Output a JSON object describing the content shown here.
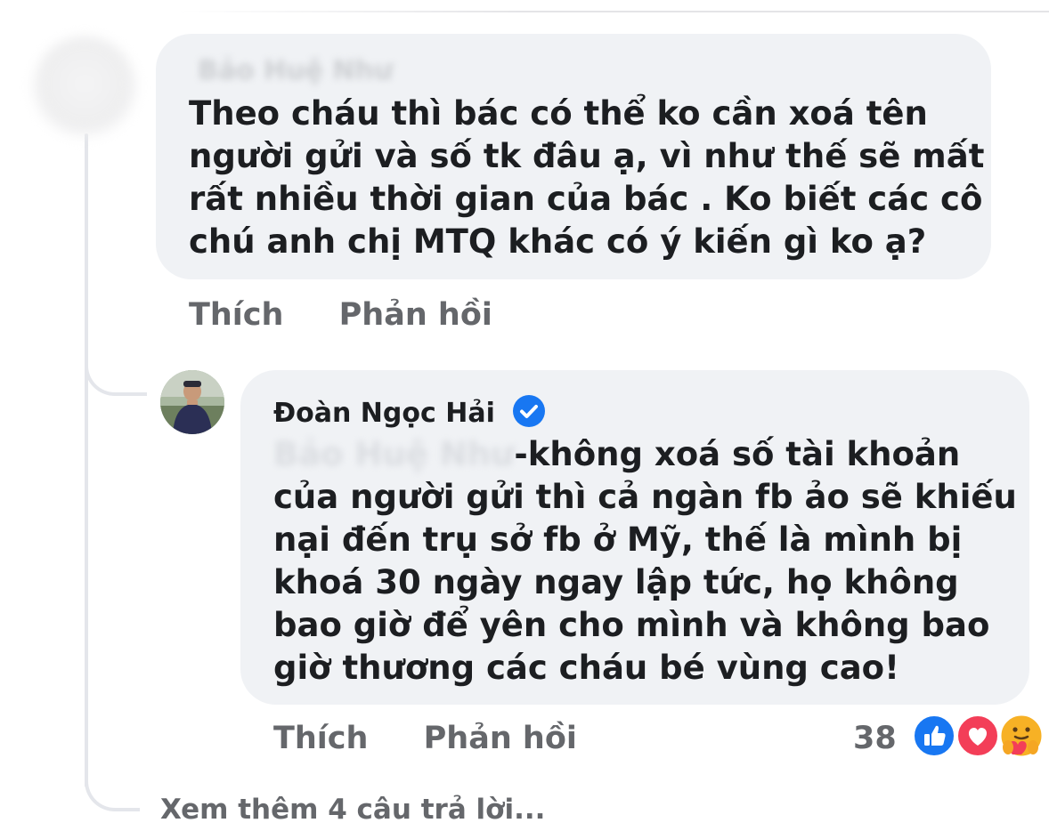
{
  "thread": {
    "parent_comment": {
      "author": "Bảo Huệ Như",
      "lines": [
        "Theo cháu thì bác có thể ko cần xoá tên",
        "người gửi và số tk đâu ạ, vì như thế sẽ mất",
        "rất nhiều thời gian của bác . Ko biết các cô",
        "chú anh chị MTQ khác có ý kiến gì ko ạ?"
      ],
      "actions": {
        "like_label": "Thích",
        "reply_label": "Phản hồi"
      }
    },
    "reply_comment": {
      "author": "Đoàn Ngọc Hải",
      "mention": "Bảo Huệ Như",
      "lines": [
        "-không xoá số tài khoản",
        "của người gửi thì cả ngàn fb ảo sẽ khiếu",
        "nại đến trụ sở fb ở Mỹ, thế là mình bị",
        "khoá 30 ngày ngay lập tức, họ không",
        "bao giờ để yên cho mình và không bao",
        "giờ thương các cháu bé vùng cao!"
      ],
      "actions": {
        "like_label": "Thích",
        "reply_label": "Phản hồi"
      },
      "reactions": {
        "count": "38",
        "types": [
          "like-icon",
          "love-icon",
          "care-icon"
        ]
      }
    },
    "more_replies_label": "Xem thêm 4 câu trả lời..."
  },
  "colors": {
    "bubble_bg": "#f0f2f5",
    "secondary_text": "#65676b",
    "primary_text": "#1c1e21",
    "verified_blue": "#1877f2",
    "love_red": "#f33e58",
    "care_yellow": "#f7b125"
  }
}
